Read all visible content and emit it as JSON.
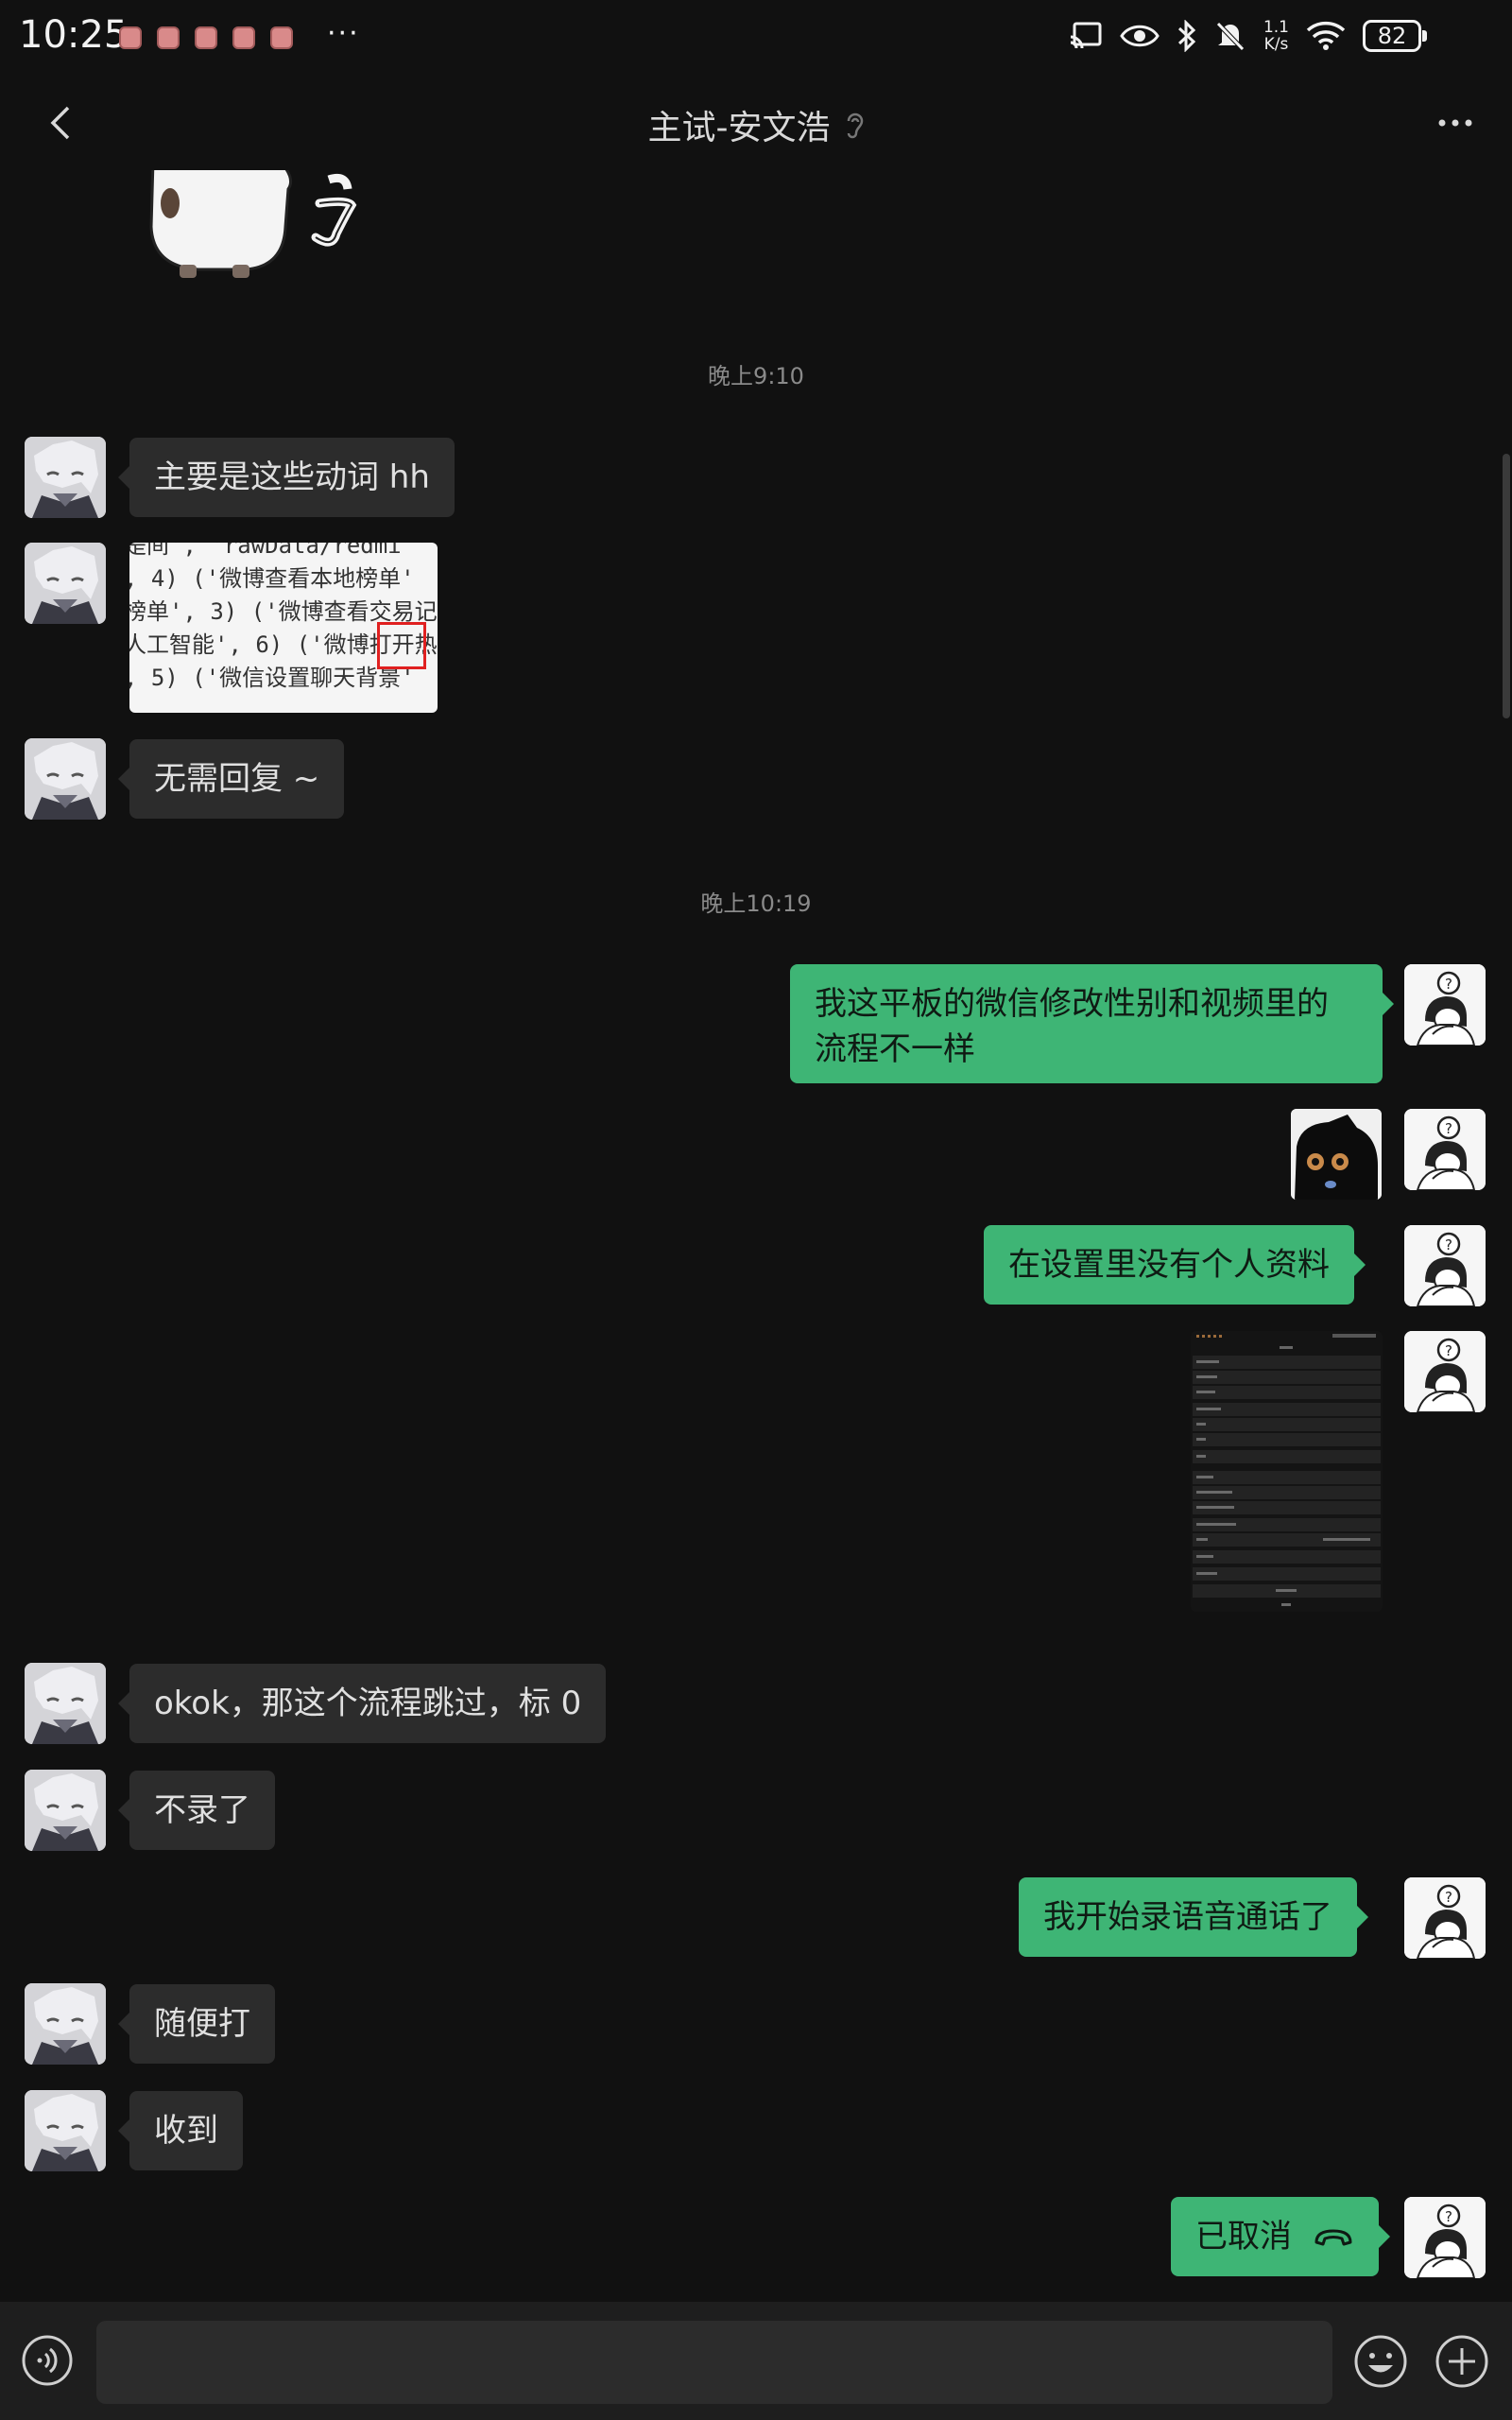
{
  "status_bar": {
    "time": "10:25",
    "more_dots": "···",
    "net_speed_value": "1.1",
    "net_speed_unit": "K/s",
    "battery": "82"
  },
  "header": {
    "title": "主试-安文浩",
    "icons": [
      "back-arrow-icon",
      "ear-icon",
      "more-dots-icon"
    ]
  },
  "messages": {
    "timestamp_1": "晚上9:10",
    "m1": "主要是这些动词 hh",
    "code_lines": [
      "是间', 'rawData/redmi '",
      ", 4) ('微博查看本地榜单'",
      "榜单', 3) ('微博查看交易记",
      "人工智能', 6) ('微博打开热",
      ", 5) ('微信设置聊天背景'"
    ],
    "m3": "无需回复 ~",
    "timestamp_2": "晚上10:19",
    "m4": "我这平板的微信修改性别和视频里的流程不一样",
    "m6": "在设置里没有个人资料",
    "m8": "okok，那这个流程跳过，标 0",
    "m9": "不录了",
    "m10": "我开始录语音通话了",
    "m11": "随便打",
    "m12": "收到",
    "m13": "已取消"
  },
  "colors": {
    "background": "#111111",
    "bubble_me": "#3eb575",
    "bubble_them": "#2c2c2c"
  },
  "input_bar": {
    "placeholder": "",
    "icons": [
      "voice-icon",
      "emoji-icon",
      "plus-icon"
    ]
  }
}
